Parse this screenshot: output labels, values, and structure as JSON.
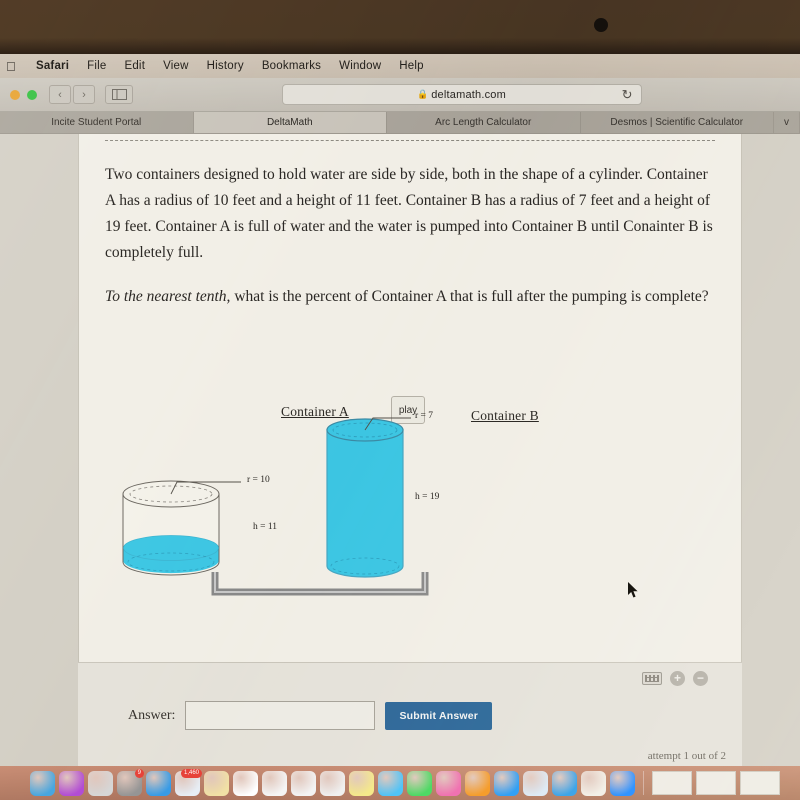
{
  "menubar": {
    "apple": "apple-logo",
    "items": [
      "Safari",
      "File",
      "Edit",
      "View",
      "History",
      "Bookmarks",
      "Window",
      "Help"
    ]
  },
  "toolbar": {
    "back_icon": "‹",
    "forward_icon": "›",
    "sidebar_icon": "sidebar-icon",
    "lock_icon": "🔒",
    "url": "deltamath.com",
    "reload_icon": "↻"
  },
  "tabs": [
    {
      "label": "Incite Student Portal",
      "active": false
    },
    {
      "label": "DeltaMath",
      "active": true
    },
    {
      "label": "Arc Length Calculator",
      "active": false
    },
    {
      "label": "Desmos | Scientific Calculator",
      "active": false
    },
    {
      "label": "v",
      "active": false
    }
  ],
  "question": {
    "paragraph1": "Two containers designed to hold water are side by side, both in the shape of a cylinder. Container A has a radius of 10 feet and a height of 11 feet. Container B has a radius of 7 feet and a height of 19 feet. Container A is full of water and the water is pumped into Container B until Conainter B is completely full.",
    "emphasis": "To the nearest tenth,",
    "paragraph2": " what is the percent of Container A that is full after the pumping is complete?"
  },
  "diagram": {
    "container_a_label": "Container A",
    "container_b_label": "Container B",
    "play_label": "play",
    "a_radius_label": "r = 10",
    "a_height_label": "h = 11",
    "b_radius_label": "r = 7",
    "b_height_label": "h = 19",
    "water_color": "#3fc8e4",
    "pipe_color": "#8d8d8d"
  },
  "answer": {
    "label": "Answer:",
    "value": "",
    "placeholder": "",
    "submit_label": "Submit Answer",
    "attempt_text": "attempt 1 out of 2",
    "keyboard_icon": "keyboard-icon",
    "zoom_in_icon": "+",
    "zoom_out_icon": "−"
  },
  "dock": {
    "icons": [
      {
        "name": "finder",
        "color": "#4aa8e0",
        "badge": ""
      },
      {
        "name": "siri",
        "color": "#b44fd6",
        "badge": ""
      },
      {
        "name": "launchpad",
        "color": "#d8d8d8",
        "badge": ""
      },
      {
        "name": "system-preferences",
        "color": "#9a9a9a",
        "badge": "9"
      },
      {
        "name": "safari",
        "color": "#3aa0e8",
        "badge": ""
      },
      {
        "name": "mail",
        "color": "#e8eef5",
        "badge": "1,460"
      },
      {
        "name": "notes",
        "color": "#f2e2a8",
        "badge": ""
      },
      {
        "name": "calendar",
        "color": "#ffffff",
        "badge": ""
      },
      {
        "name": "reminders",
        "color": "#f6f6f6",
        "badge": ""
      },
      {
        "name": "photos",
        "color": "#f4f4f4",
        "badge": ""
      },
      {
        "name": "contacts",
        "color": "#f0f0f0",
        "badge": ""
      },
      {
        "name": "stickies",
        "color": "#f5e98a",
        "badge": ""
      },
      {
        "name": "messages",
        "color": "#4fc3f7",
        "badge": ""
      },
      {
        "name": "facetime",
        "color": "#4cd964",
        "badge": ""
      },
      {
        "name": "itunes",
        "color": "#f06fb0",
        "badge": ""
      },
      {
        "name": "ibooks",
        "color": "#f59a2b",
        "badge": ""
      },
      {
        "name": "app-store",
        "color": "#2f9cf4",
        "badge": ""
      },
      {
        "name": "preview",
        "color": "#dce9f5",
        "badge": ""
      },
      {
        "name": "keynote",
        "color": "#3aa0e8",
        "badge": ""
      },
      {
        "name": "pages",
        "color": "#f2efe6",
        "badge": ""
      },
      {
        "name": "zoom-app",
        "color": "#2d8cff",
        "badge": ""
      }
    ]
  },
  "cursor": {
    "name": "mouse-pointer"
  }
}
